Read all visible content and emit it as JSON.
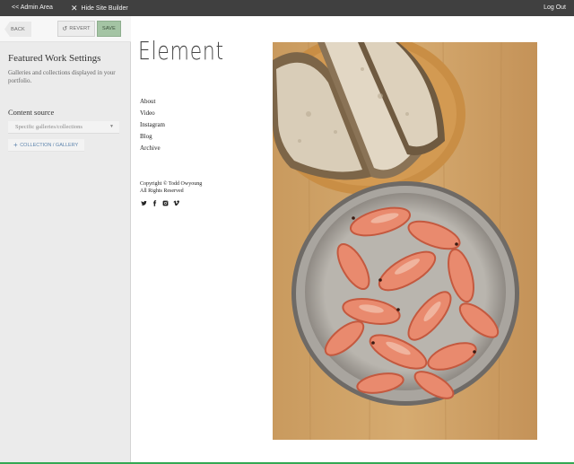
{
  "topbar": {
    "admin_area": "<< Admin Area",
    "hide_site_builder": "Hide Site Builder",
    "log_out": "Log Out"
  },
  "panel": {
    "back_label": "BACK",
    "revert_label": "REVERT",
    "save_label": "SAVE",
    "title": "Featured Work Settings",
    "description": "Galleries and collections displayed in your portfolio.",
    "content_source_label": "Content source",
    "content_source_value": "Specific galleries/collections",
    "add_collection_label": "COLLECTION / GALLERY"
  },
  "site": {
    "title": "Element",
    "nav": [
      "About",
      "Video",
      "Instagram",
      "Blog",
      "Archive"
    ],
    "copyright_line1": "Copyright © Todd Owyoung",
    "copyright_line2": "All Rights Reserved",
    "social_icons": [
      "twitter-icon",
      "facebook-icon",
      "instagram-icon",
      "vimeo-icon"
    ]
  },
  "colors": {
    "topbar_bg": "#404040",
    "panel_bg": "#ebebeb",
    "save_bg": "#a4c4a4",
    "link_blue": "#5d84ad",
    "status_green": "#34a853"
  }
}
